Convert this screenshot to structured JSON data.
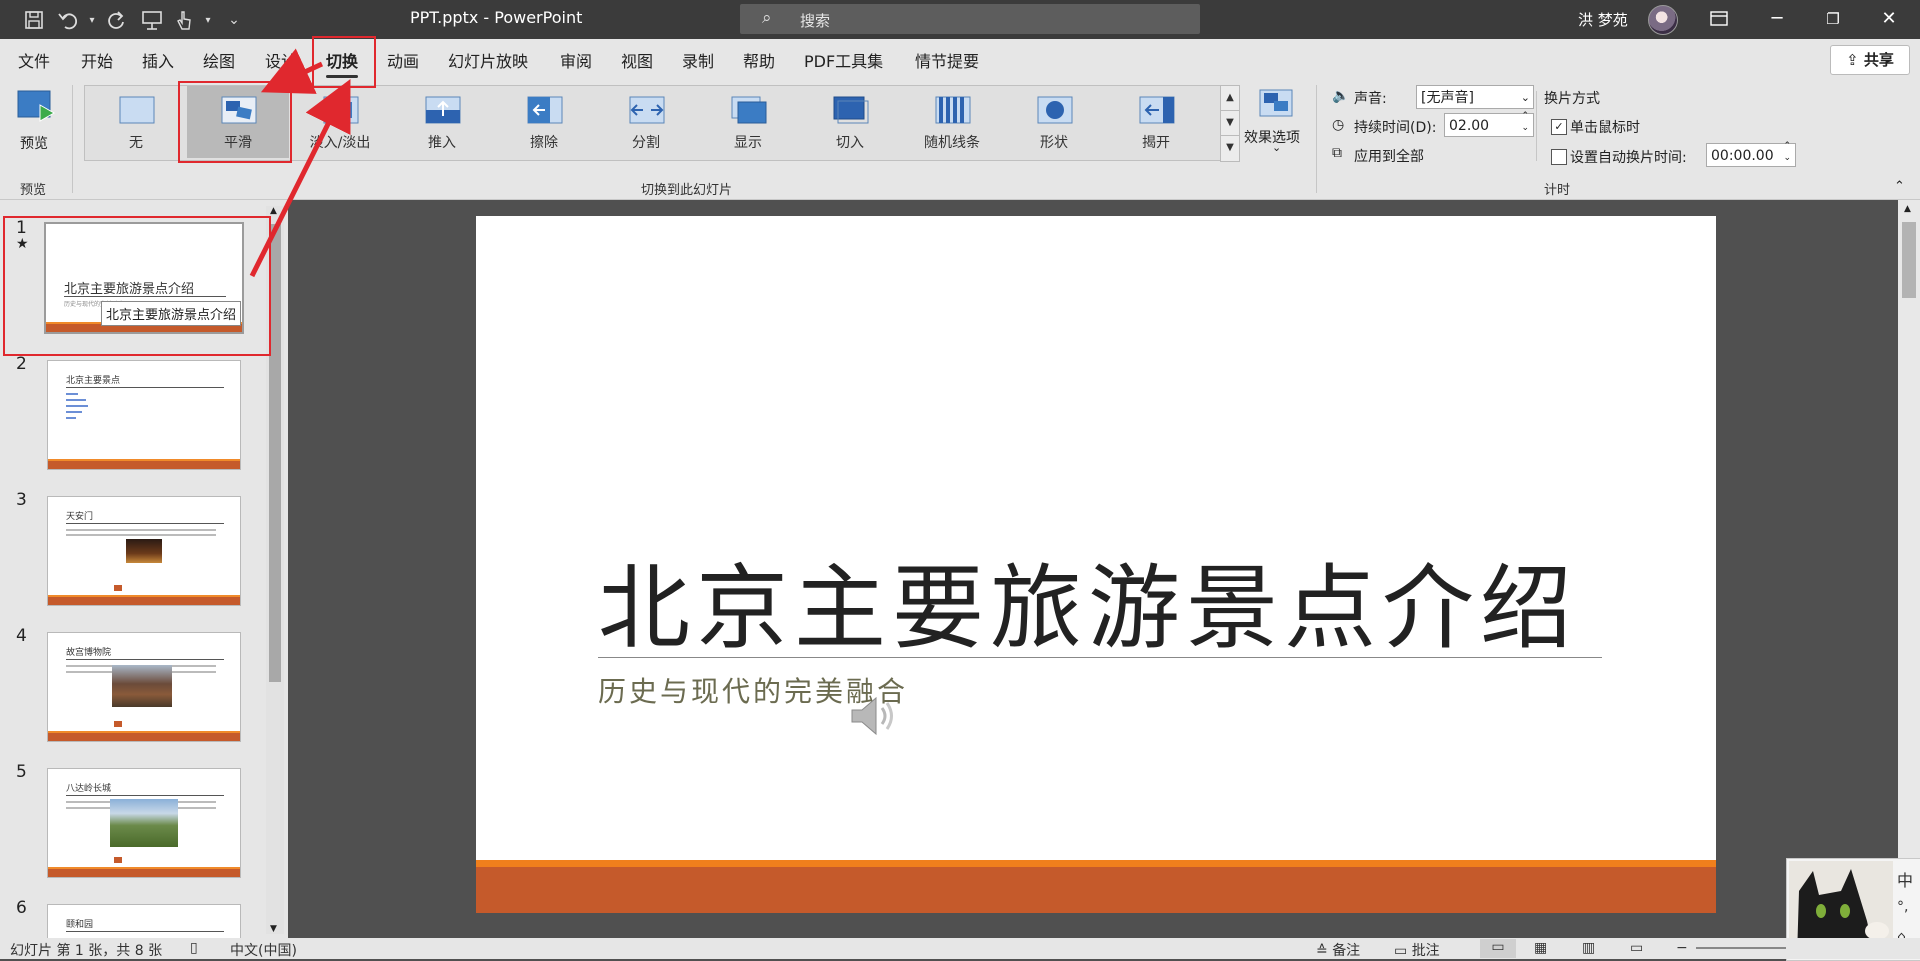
{
  "titlebar": {
    "doc_title": "PPT.pptx  -  PowerPoint",
    "search_placeholder": "搜索",
    "user_name": "洪 梦苑",
    "window_buttons": [
      "restore-ribbon",
      "minimize",
      "maximize",
      "close"
    ]
  },
  "menu": {
    "tabs": [
      "文件",
      "开始",
      "插入",
      "绘图",
      "设计",
      "切换",
      "动画",
      "幻灯片放映",
      "审阅",
      "视图",
      "录制",
      "帮助",
      "PDF工具集",
      "情节提要"
    ],
    "active_tab": "切换",
    "share_label": "共享"
  },
  "ribbon": {
    "preview_label": "预览",
    "preview_group_label": "预览",
    "transitions": [
      "无",
      "平滑",
      "淡入/淡出",
      "推入",
      "擦除",
      "分割",
      "显示",
      "切入",
      "随机线条",
      "形状",
      "揭开"
    ],
    "selected_transition": "平滑",
    "effect_options_label": "效果选项",
    "gallery_group_label": "切换到此幻灯片",
    "sound_label": "声音:",
    "sound_value": "[无声音]",
    "duration_label": "持续时间(D):",
    "duration_value": "02.00",
    "apply_all_label": "应用到全部",
    "advance_label": "换片方式",
    "on_click_label": "单击鼠标时",
    "on_click_checked": true,
    "auto_after_label": "设置自动换片时间:",
    "auto_after_checked": false,
    "auto_after_value": "00:00.00",
    "timing_group_label": "计时"
  },
  "slides_pane": {
    "slides": [
      {
        "num": "1",
        "title": "北京主要旅游景点介绍",
        "subtitle": "历史与现代的完美融合"
      },
      {
        "num": "2",
        "title": "北京主要景点"
      },
      {
        "num": "3",
        "title": "天安门"
      },
      {
        "num": "4",
        "title": "故宫博物院"
      },
      {
        "num": "5",
        "title": "八达岭长城"
      },
      {
        "num": "6",
        "title": "颐和园"
      }
    ],
    "current_marker": "★",
    "tooltip": "北京主要旅游景点介绍"
  },
  "slide": {
    "title": "北京主要旅游景点介绍",
    "subtitle": "历史与现代的完美融合"
  },
  "status": {
    "slide_info": "幻灯片 第 1 张，共 8 张",
    "language": "中文(中国)",
    "notes_label": "备注",
    "comments_label": "批注"
  },
  "ime": {
    "mode": "中",
    "punct": "°,",
    "colors": {
      "accent_red": "#e0282e",
      "slide_rust": "#c55a2b",
      "slide_orange": "#f07f1c"
    }
  }
}
